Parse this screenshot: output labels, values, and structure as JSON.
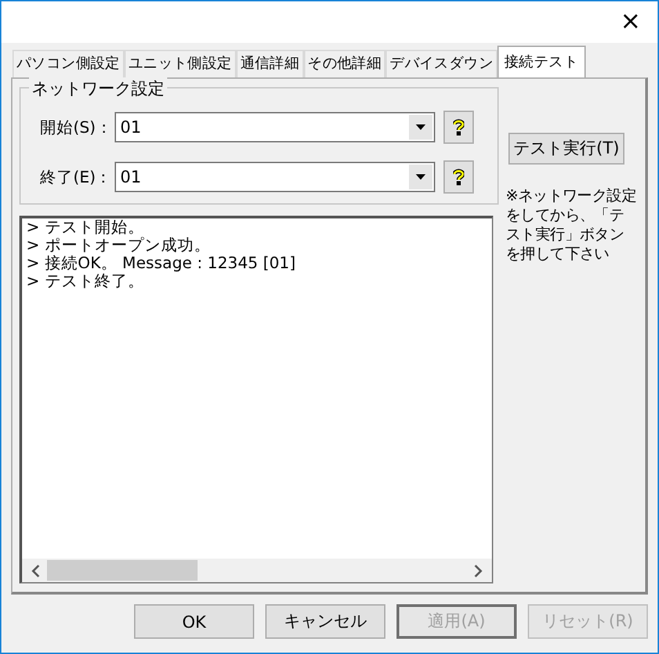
{
  "window": {
    "close_button": "×"
  },
  "tabs": [
    {
      "label": "パソコン側設定",
      "selected": false
    },
    {
      "label": "ユニット側設定",
      "selected": false
    },
    {
      "label": "通信詳細",
      "selected": false
    },
    {
      "label": "その他詳細",
      "selected": false
    },
    {
      "label": "デバイスダウン",
      "selected": false
    },
    {
      "label": "接続テスト",
      "selected": true
    }
  ],
  "network_group": {
    "title": "ネットワーク設定",
    "fields": [
      {
        "label": "開始(S)：",
        "value": "01"
      },
      {
        "label": "終了(E)：",
        "value": "01"
      }
    ]
  },
  "test_button": "テスト実行(T)",
  "note": "※ネットワーク設定をしてから、「テスト実行」ボタンを押して下さい",
  "log": {
    "lines": [
      "> テスト開始。",
      "> ポートオープン成功。",
      "> 接続OK。 Message : 12345 [01]",
      "> テスト終了。"
    ]
  },
  "buttons": [
    {
      "label": "OK",
      "disabled": false,
      "focused": false
    },
    {
      "label": "キャンセル",
      "disabled": false,
      "focused": false
    },
    {
      "label": "適用(A)",
      "disabled": true,
      "focused": true
    },
    {
      "label": "リセット(R)",
      "disabled": true,
      "focused": false
    }
  ]
}
